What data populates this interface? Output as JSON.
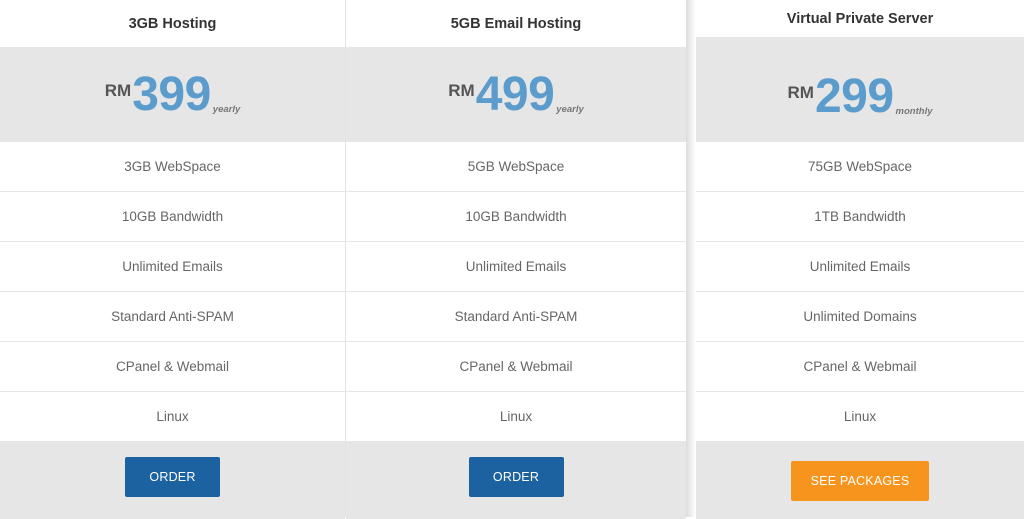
{
  "plans": [
    {
      "title": "3GB Hosting",
      "currency": "RM",
      "amount": "399",
      "period": "yearly",
      "features": [
        "3GB WebSpace",
        "10GB Bandwidth",
        "Unlimited Emails",
        "Standard Anti-SPAM",
        "CPanel & Webmail",
        "Linux"
      ],
      "button": "ORDER",
      "button_color": "#1c62a0"
    },
    {
      "title": "5GB Email Hosting",
      "currency": "RM",
      "amount": "499",
      "period": "yearly",
      "features": [
        "5GB WebSpace",
        "10GB Bandwidth",
        "Unlimited Emails",
        "Standard Anti-SPAM",
        "CPanel & Webmail",
        "Linux"
      ],
      "button": "ORDER",
      "button_color": "#1c62a0"
    },
    {
      "title": "Virtual Private Server",
      "currency": "RM",
      "amount": "299",
      "period": "monthly",
      "features": [
        "75GB WebSpace",
        "1TB Bandwidth",
        "Unlimited Emails",
        "Unlimited Domains",
        "CPanel & Webmail",
        "Linux"
      ],
      "button": "SEE PACKAGES",
      "button_color": "#f7941d"
    }
  ],
  "colors": {
    "price_text": "#5b9ccc",
    "band_background": "#e6e6e6"
  }
}
